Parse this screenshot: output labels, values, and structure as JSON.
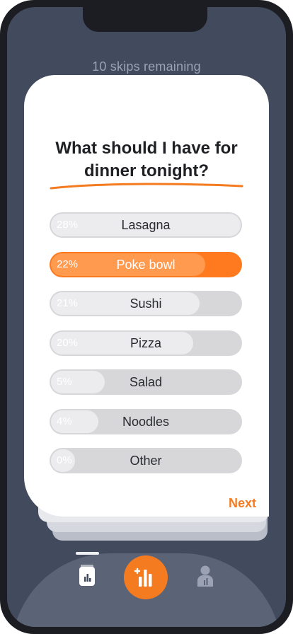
{
  "header": {
    "skips_text": "10 skips remaining"
  },
  "poll": {
    "question": "What should I have for dinner tonight?",
    "options": [
      {
        "percent": "28%",
        "label": "Lasagna",
        "value": 28,
        "selected": false
      },
      {
        "percent": "22%",
        "label": "Poke bowl",
        "value": 22,
        "selected": true
      },
      {
        "percent": "21%",
        "label": "Sushi",
        "value": 21,
        "selected": false
      },
      {
        "percent": "20%",
        "label": "Pizza",
        "value": 20,
        "selected": false
      },
      {
        "percent": "5%",
        "label": "Salad",
        "value": 5,
        "selected": false
      },
      {
        "percent": "4%",
        "label": "Noodles",
        "value": 4,
        "selected": false
      },
      {
        "percent": "0%",
        "label": "Other",
        "value": 0,
        "selected": false
      }
    ],
    "next_label": "Next"
  },
  "tabbar": {
    "tabs": [
      {
        "icon": "cards-icon",
        "active": true
      },
      {
        "icon": "add-poll-icon",
        "active": false
      },
      {
        "icon": "profile-icon",
        "active": false
      }
    ]
  },
  "colors": {
    "accent": "#f47b20",
    "background": "#424a5e",
    "card": "#ffffff",
    "bar_track": "#d7d7da",
    "bar_fill": "#ececee"
  }
}
